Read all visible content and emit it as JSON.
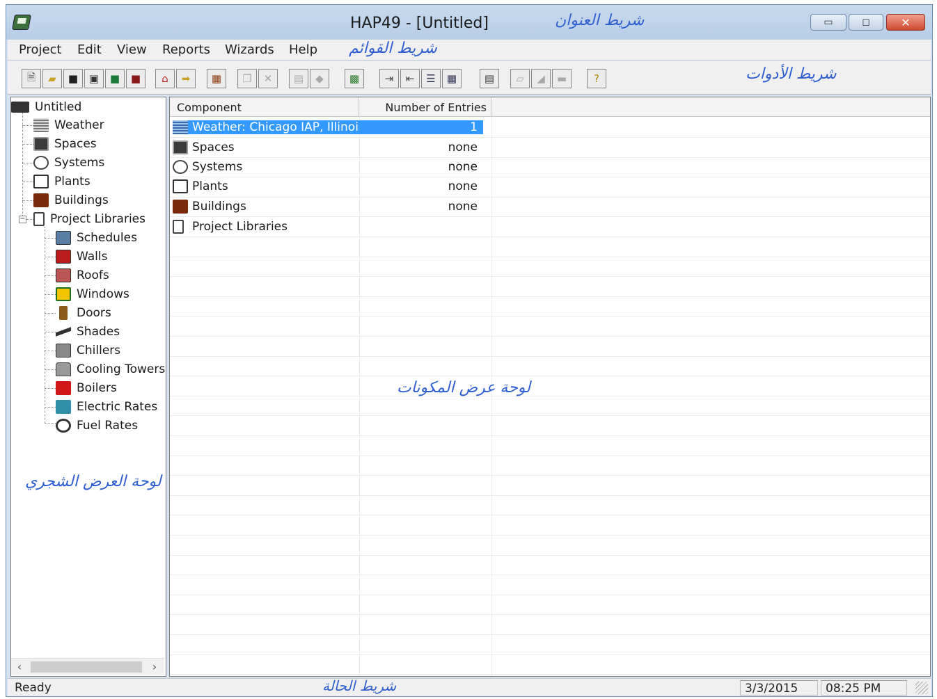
{
  "window": {
    "title": "HAP49 - [Untitled]",
    "annot_title_bar": "شريط العنوان",
    "annot_menu_bar": "شريط القوائم",
    "annot_toolbar": "شريط الأدوات",
    "annot_component_pane": "لوحة عرض المكونات",
    "annot_tree_pane": "لوحة العرض الشجري",
    "annot_status_bar": "شريط الحالة"
  },
  "menubar": {
    "items": [
      "Project",
      "Edit",
      "View",
      "Reports",
      "Wizards",
      "Help"
    ]
  },
  "toolbar": {
    "icons": [
      "new-icon",
      "open-icon",
      "save-icon",
      "book-icon",
      "save-green-icon",
      "save-red-icon",
      "build-icon",
      "export-icon",
      "wall-icon",
      "copy-icon",
      "delete-icon",
      "properties-icon",
      "diamond-icon",
      "calc-icon",
      "move-left-icon",
      "move-right-icon",
      "list-view-icon",
      "details-view-icon",
      "form-icon",
      "report-icon",
      "chart-icon",
      "print-icon",
      "help-icon"
    ]
  },
  "tree": {
    "root": "Untitled",
    "items": [
      {
        "label": "Weather",
        "icon": "weather-icon"
      },
      {
        "label": "Spaces",
        "icon": "spaces-icon"
      },
      {
        "label": "Systems",
        "icon": "systems-icon"
      },
      {
        "label": "Plants",
        "icon": "plants-icon"
      },
      {
        "label": "Buildings",
        "icon": "buildings-icon"
      },
      {
        "label": "Project Libraries",
        "icon": "library-icon"
      }
    ],
    "library_items": [
      {
        "label": "Schedules",
        "icon": "schedules-icon"
      },
      {
        "label": "Walls",
        "icon": "walls-icon"
      },
      {
        "label": "Roofs",
        "icon": "roofs-icon"
      },
      {
        "label": "Windows",
        "icon": "windows-icon"
      },
      {
        "label": "Doors",
        "icon": "doors-icon"
      },
      {
        "label": "Shades",
        "icon": "shades-icon"
      },
      {
        "label": "Chillers",
        "icon": "chillers-icon"
      },
      {
        "label": "Cooling Towers",
        "icon": "cooling-towers-icon"
      },
      {
        "label": "Boilers",
        "icon": "boilers-icon"
      },
      {
        "label": "Electric Rates",
        "icon": "electric-rates-icon"
      },
      {
        "label": "Fuel Rates",
        "icon": "fuel-rates-icon"
      }
    ]
  },
  "list": {
    "columns": [
      "Component",
      "Number of Entries"
    ],
    "rows": [
      {
        "name": "Weather: Chicago IAP, Illinois",
        "count": "1",
        "selected": true,
        "icon": "weather-icon"
      },
      {
        "name": "Spaces",
        "count": "none",
        "icon": "spaces-icon"
      },
      {
        "name": "Systems",
        "count": "none",
        "icon": "systems-icon"
      },
      {
        "name": "Plants",
        "count": "none",
        "icon": "plants-icon"
      },
      {
        "name": "Buildings",
        "count": "none",
        "icon": "buildings-icon"
      },
      {
        "name": "Project Libraries",
        "count": "",
        "icon": "library-icon"
      }
    ]
  },
  "statusbar": {
    "status": "Ready",
    "date": "3/3/2015",
    "time": "08:25 PM"
  },
  "colors": {
    "selection": "#3399ff",
    "annotation": "#2f5fd0",
    "titlebar": "#c9daee"
  }
}
